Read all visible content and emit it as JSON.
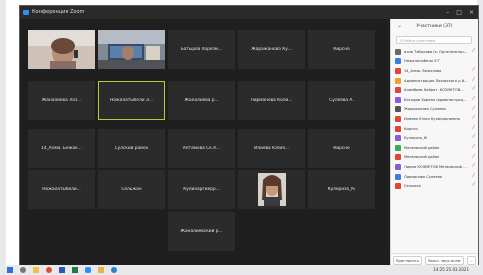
{
  "window": {
    "title": "Конференция Zoom"
  },
  "grid_tiles": [
    {
      "name": "",
      "kind": "video",
      "scene": "person-headset"
    },
    {
      "name": "",
      "kind": "video",
      "scene": "office-screen"
    },
    {
      "name": "Батыров Хорезм...",
      "kind": "name"
    },
    {
      "name": "Жаражанова Ку...",
      "kind": "name"
    },
    {
      "name": "Кирсно",
      "kind": "name"
    },
    {
      "name": "Жаналиева Лаз...",
      "kind": "name"
    },
    {
      "name": "Нажалатыбели Э...",
      "kind": "name",
      "active": true
    },
    {
      "name": "Жаналиева р...",
      "kind": "name"
    },
    {
      "name": "Лирманова Коли...",
      "kind": "name"
    },
    {
      "name": "Сулеева А.",
      "kind": "name"
    },
    {
      "name": "14_Алма. Бежак...",
      "kind": "name"
    },
    {
      "name": "Сулский район",
      "kind": "name"
    },
    {
      "name": "Аптамова Ск.А...",
      "kind": "name"
    },
    {
      "name": "Илиева Юлия...",
      "kind": "name"
    },
    {
      "name": "Кирсно",
      "kind": "name"
    },
    {
      "name": "Нажалатыбели...",
      "kind": "name"
    },
    {
      "name": "Сельжан",
      "kind": "name"
    },
    {
      "name": "Кулинаргиерр...",
      "kind": "name"
    },
    {
      "name": "",
      "kind": "video",
      "scene": "portrait-woman"
    },
    {
      "name": "Кулериза_Кі",
      "kind": "name"
    },
    {
      "name": "Жаналиевский р...",
      "kind": "name"
    }
  ],
  "participants_panel": {
    "title": "Участники (37)",
    "search_placeholder": "Q Найти участника",
    "participants": [
      {
        "name": "алла Табысова (к. Организатор, я)",
        "color": "#6a6a6a",
        "muted": true
      },
      {
        "name": "Нажалатыбели Э.Т",
        "color": "#3c7fd8",
        "muted": false
      },
      {
        "name": "14_Алма. Бежалова",
        "color": "#e0443a",
        "muted": true
      },
      {
        "name": "Администрация Лоховского р-й...",
        "color": "#f0a02b",
        "muted": true
      },
      {
        "name": "Алимбаев Кайрат. КОЗМЕТОВ...",
        "color": "#e0443a",
        "muted": true
      },
      {
        "name": "Батыров Хорезм (администрац...",
        "color": "#8a5cd6",
        "muted": true
      },
      {
        "name": "Жаражанова Сулеева",
        "color": "#555555",
        "muted": true
      },
      {
        "name": "Илиева Юлия Кулинаргиевна",
        "color": "#e0443a",
        "muted": true
      },
      {
        "name": "Кирсно",
        "color": "#e0443a",
        "muted": true
      },
      {
        "name": "Кулериза_Кі",
        "color": "#8a5cd6",
        "muted": true
      },
      {
        "name": "Мелехвский район",
        "color": "#3ca85a",
        "muted": true
      },
      {
        "name": "Мелехвский район",
        "color": "#e0443a",
        "muted": true
      },
      {
        "name": "Лирма КОЗМЕТОВ Мелехвский район",
        "color": "#8a5cd6",
        "muted": true
      },
      {
        "name": "Лирманова Сулеева",
        "color": "#3c7fd8",
        "muted": true
      },
      {
        "name": "Сельжан",
        "color": "#e0443a",
        "muted": true
      }
    ],
    "footer": {
      "invite_label": "Пригласить",
      "mute_all_label": "Выкл. звук всем",
      "more_label": "..."
    }
  },
  "taskbar": {
    "time": "14:25",
    "date": "25.03.2021",
    "icons": [
      "windows-icon",
      "search-icon",
      "file-explorer-icon",
      "chrome-icon",
      "word-icon",
      "excel-icon",
      "zoom-icon",
      "folder-icon",
      "edge-icon"
    ]
  }
}
